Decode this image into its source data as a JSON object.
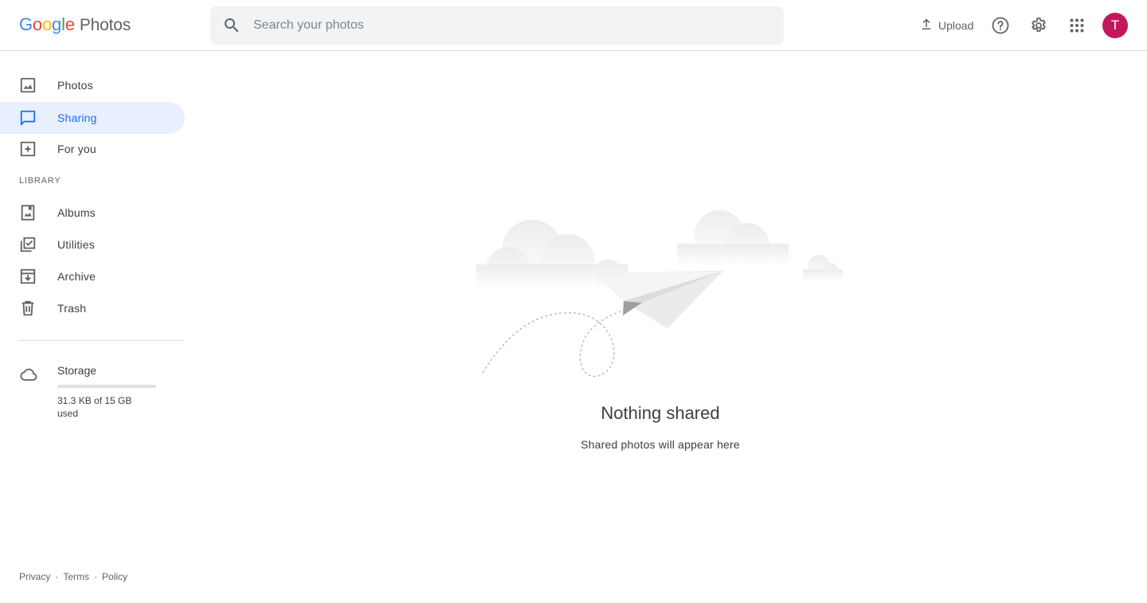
{
  "header": {
    "logo_google": "Google",
    "logo_product": "Photos",
    "search_placeholder": "Search your photos",
    "upload_label": "Upload",
    "avatar_initial": "T"
  },
  "sidebar": {
    "items": [
      {
        "label": "Photos",
        "icon": "photo-icon",
        "active": false
      },
      {
        "label": "Sharing",
        "icon": "chat-icon",
        "active": true
      },
      {
        "label": "For you",
        "icon": "sparkle-icon",
        "active": false
      }
    ],
    "library_label": "LIBRARY",
    "library_items": [
      {
        "label": "Albums",
        "icon": "album-icon"
      },
      {
        "label": "Utilities",
        "icon": "checklist-icon"
      },
      {
        "label": "Archive",
        "icon": "archive-icon"
      },
      {
        "label": "Trash",
        "icon": "trash-icon"
      }
    ],
    "storage": {
      "title": "Storage",
      "usage": "31.3 KB of 15 GB used",
      "fraction_used": 2e-06
    }
  },
  "main": {
    "empty_title": "Nothing shared",
    "empty_subtitle": "Shared photos will appear here"
  },
  "footer": {
    "links": [
      "Privacy",
      "Terms",
      "Policy"
    ],
    "separator": "·"
  },
  "colors": {
    "accent": "#1a73e8",
    "active_bg": "#e8f0fe",
    "avatar": "#c2185b"
  }
}
